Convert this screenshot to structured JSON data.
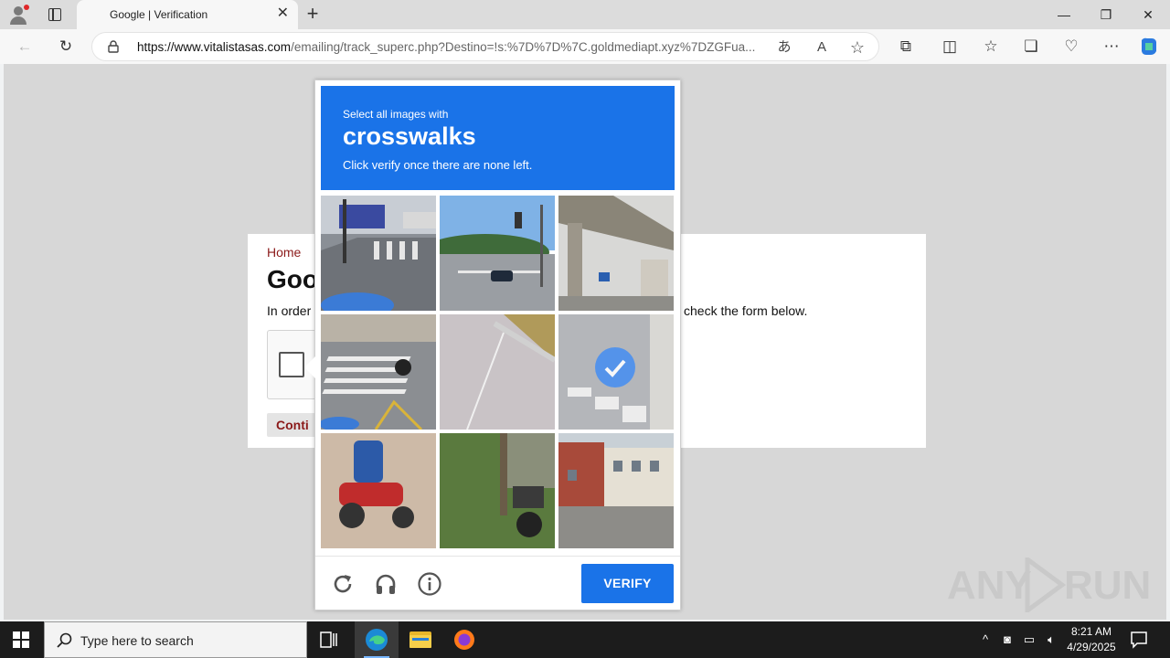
{
  "browser": {
    "tab_title": "Google | Verification",
    "tab_close": "✕",
    "new_tab": "+",
    "url_host": "https://www.vitalistasas.com",
    "url_path": "/emailing/track_superc.php?Destino=!s:%7D%7D%7C.goldmediapt.xyz%7DZGFua...",
    "window_minimize": "—",
    "window_restore": "❐",
    "window_close": "✕"
  },
  "page": {
    "breadcrumb": "Home",
    "heading": "Goo",
    "intro_left": "In order",
    "intro_right": "check the form below.",
    "continue_label": "Conti"
  },
  "captcha": {
    "instruction_top": "Select all images with",
    "target": "crosswalks",
    "instruction_bottom": "Click verify once there are none left.",
    "verify_label": "VERIFY",
    "tiles": [
      {
        "name": "street-corner-crosswalk",
        "selected": false
      },
      {
        "name": "road-traffic-light",
        "selected": false
      },
      {
        "name": "overpass",
        "selected": false
      },
      {
        "name": "intersection-motorcycle",
        "selected": false
      },
      {
        "name": "empty-road",
        "selected": false
      },
      {
        "name": "crosswalk-selected",
        "selected": true
      },
      {
        "name": "motorcyclist",
        "selected": false
      },
      {
        "name": "grass-motorcycle",
        "selected": false
      },
      {
        "name": "brick-building",
        "selected": false
      }
    ]
  },
  "watermark": {
    "left": "ANY",
    "right": "RUN"
  },
  "taskbar": {
    "search_placeholder": "Type here to search",
    "time": "8:21 AM",
    "date": "4/29/2025"
  },
  "colors": {
    "captcha_blue": "#1a73e8",
    "brand_red": "#8b1a1a"
  }
}
